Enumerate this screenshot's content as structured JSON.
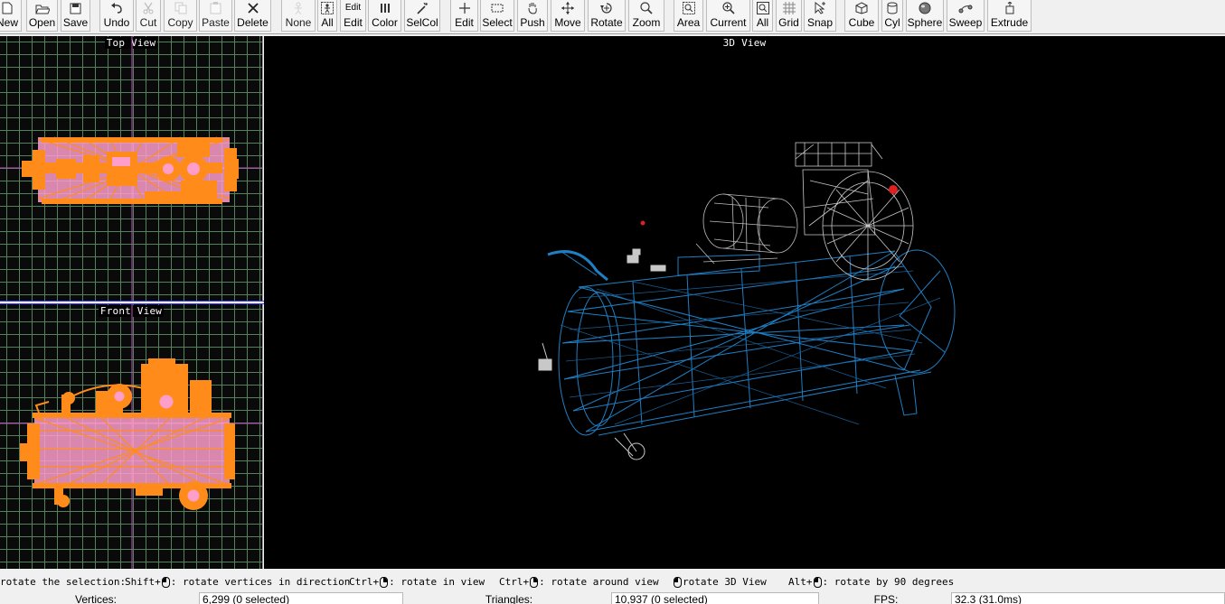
{
  "toolbar": {
    "buttons": [
      {
        "label": "New",
        "icon": "new-file-icon"
      },
      {
        "label": "Open",
        "icon": "open-folder-icon"
      },
      {
        "label": "Save",
        "icon": "save-disk-icon"
      },
      {
        "label": "Undo",
        "icon": "undo-arrow-icon"
      },
      {
        "label": "Cut",
        "icon": "scissors-icon"
      },
      {
        "label": "Copy",
        "icon": "copy-icon"
      },
      {
        "label": "Paste",
        "icon": "paste-clipboard-icon"
      },
      {
        "label": "Delete",
        "icon": "delete-x-icon"
      },
      {
        "label": "None",
        "icon": "select-none-icon"
      },
      {
        "label": "All",
        "icon": "select-all-icon"
      },
      {
        "label": "Edit",
        "icon": "edit-text-icon",
        "icon_text": "Edit"
      },
      {
        "label": "Color",
        "icon": "color-bars-icon"
      },
      {
        "label": "SelCol",
        "icon": "magic-wand-icon"
      },
      {
        "label": "Edit",
        "icon": "plus-cross-icon"
      },
      {
        "label": "Select",
        "icon": "select-rectangle-icon"
      },
      {
        "label": "Push",
        "icon": "push-hand-icon"
      },
      {
        "label": "Move",
        "icon": "move-arrows-icon"
      },
      {
        "label": "Rotate",
        "icon": "rotate-icon"
      },
      {
        "label": "Zoom",
        "icon": "zoom-magnifier-icon"
      },
      {
        "label": "Area",
        "icon": "zoom-area-icon"
      },
      {
        "label": "Current",
        "icon": "zoom-current-icon"
      },
      {
        "label": "All",
        "icon": "zoom-all-icon"
      },
      {
        "label": "Grid",
        "icon": "grid-icon"
      },
      {
        "label": "Snap",
        "icon": "snap-cursor-icon"
      },
      {
        "label": "Cube",
        "icon": "cube-icon"
      },
      {
        "label": "Cyl",
        "icon": "cylinder-icon"
      },
      {
        "label": "Sphere",
        "icon": "sphere-icon"
      },
      {
        "label": "Sweep",
        "icon": "sweep-icon"
      },
      {
        "label": "Extrude",
        "icon": "extrude-icon"
      }
    ]
  },
  "views": {
    "top": "Top View",
    "front": "Front View",
    "perspective": "3D View"
  },
  "colors": {
    "selection_orange": "#ff8c1a",
    "selection_pink": "#ff9ecb",
    "mesh_blue": "#1f7fc4",
    "mesh_grey": "#b5b5b5",
    "grid_green": "#53825a",
    "axis_magenta": "#c050c0"
  },
  "hints": [
    {
      "pre": "rotate the selection:",
      "mouse": "",
      "post": ""
    },
    {
      "pre": "Shift+",
      "mouse": "left",
      "post": ": rotate vertices in direction"
    },
    {
      "pre": "Ctrl+",
      "mouse": "right",
      "post": ": rotate in view"
    },
    {
      "pre": "Ctrl+",
      "mouse": "right",
      "post": ": rotate around view"
    },
    {
      "pre": "",
      "mouse": "left",
      "post": "rotate 3D View"
    },
    {
      "pre": "Alt+",
      "mouse": "left",
      "post": ": rotate by 90 degrees"
    }
  ],
  "status": {
    "vertices_label": "Vertices:",
    "vertices_value": "6,299   (0 selected)",
    "triangles_label": "Triangles:",
    "triangles_value": "10,937   (0 selected)",
    "fps_label": "FPS:",
    "fps_value": "32.3 (31.0ms)"
  }
}
